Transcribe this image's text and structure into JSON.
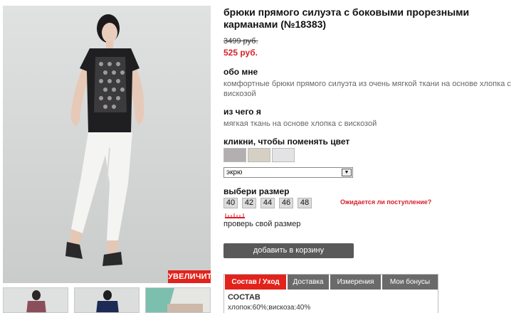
{
  "product": {
    "title": "брюки прямого силуэта с боковыми прорезными карманами (№18383)",
    "old_price": "3499 руб.",
    "new_price": "525 руб."
  },
  "photo": {
    "zoom_label": "УВЕЛИЧИТЬ"
  },
  "about": {
    "heading": "обо мне",
    "text": "комфортные брюки прямого силуэта из очень мягкой ткани на основе хлопка с вискозой"
  },
  "material": {
    "heading": "из чего я",
    "text": "мягкая ткань на основе хлопка с вискозой"
  },
  "color": {
    "heading": "кликни, чтобы поменять цвет",
    "swatches": [
      "#b3aeaf",
      "#d6d0c4",
      "#e3e2e4"
    ],
    "selected": "экрю"
  },
  "size": {
    "heading": "выбери размер",
    "options": [
      "40",
      "42",
      "44",
      "46",
      "48"
    ],
    "waiting_link": "Ожидается ли поступление?",
    "check_label": "проверь свой размер"
  },
  "cart": {
    "button_label": "добавить в корзину"
  },
  "tabs": {
    "items": [
      "Состав / Уход",
      "Доставка",
      "Измерения",
      "Мои бонусы"
    ],
    "active": "Состав / Уход",
    "content_heading": "СОСТАВ",
    "content_text": "хлопок:60%;вискоза:40%"
  },
  "colors": {
    "accent": "#e2221b",
    "price": "#d8202a",
    "button": "#595959"
  }
}
